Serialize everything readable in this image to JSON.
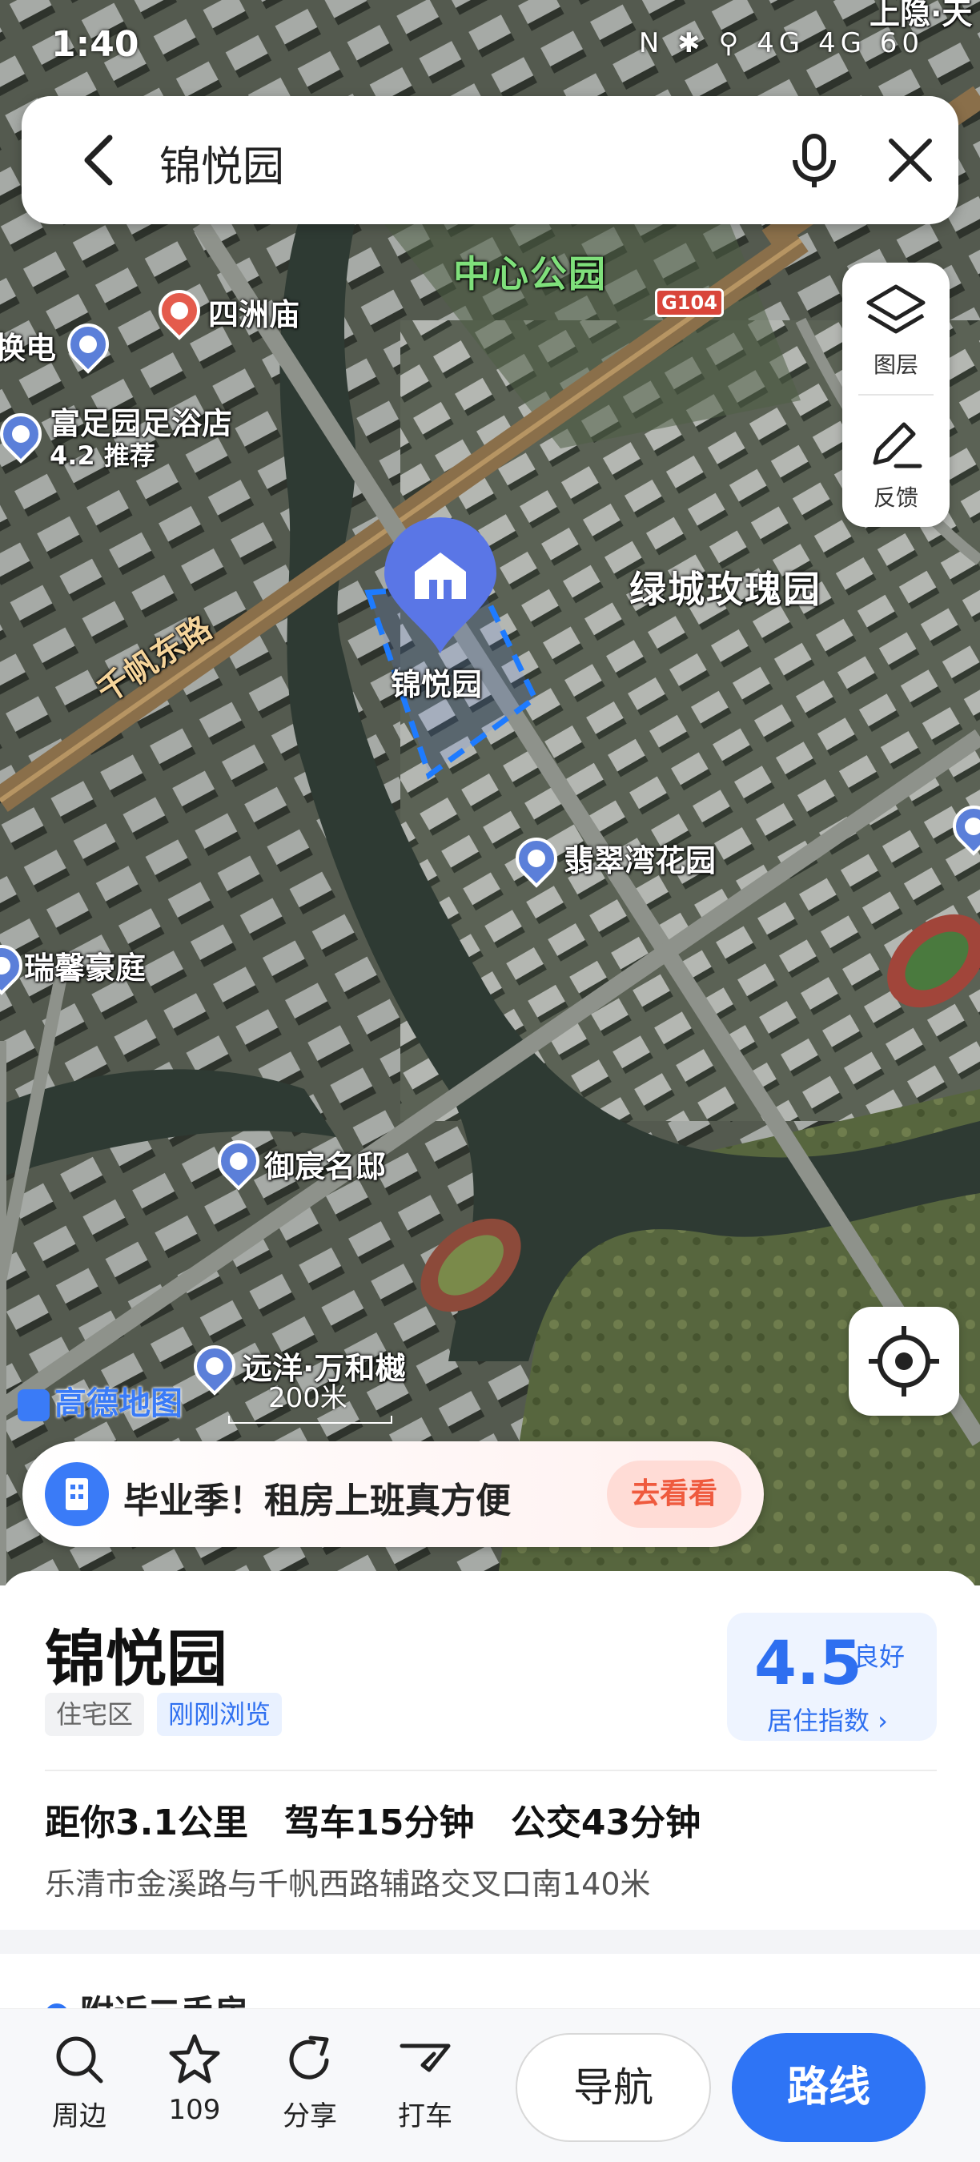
{
  "status_bar": {
    "time": "1:40",
    "right_icons": "N ✱ ⚲ 4G 4G 60",
    "top_right_poi": "上隐·天"
  },
  "search": {
    "query": "锦悦园"
  },
  "map_tools": {
    "layers_label": "图层",
    "feedback_label": "反馈"
  },
  "map_labels": {
    "central_park": "中心公园",
    "highway": "G104",
    "sizhou_temple": "四洲庙",
    "partial_left": "换电",
    "foot_spa": "富足园足浴店",
    "foot_spa_sub": "4.2 推荐",
    "road": "千帆东路",
    "lvcheng": "绿城玫瑰园",
    "selected": "锦悦园",
    "feicui": "翡翠湾花园",
    "ruixin": "瑞馨豪庭",
    "yuchen": "御宸名邸",
    "yuanyang": "远洋·万和樾"
  },
  "map_footer": {
    "brand": "高德地图",
    "scale": "200米"
  },
  "banner": {
    "text": "毕业季！租房上班真方便",
    "button": "去看看"
  },
  "place": {
    "title": "锦悦园",
    "tag_type": "住宅区",
    "tag_recent": "刚刚浏览",
    "score": "4.5",
    "score_level": "良好",
    "score_label": "居住指数 ›",
    "distance": "距你3.1公里",
    "drive": "驾车15分钟",
    "transit": "公交43分钟",
    "address": "乐清市金溪路与千帆西路辅路交叉口南140米",
    "next_section": "附近二手房"
  },
  "actions": {
    "nearby": "周边",
    "favorites": "109",
    "share": "分享",
    "taxi": "打车",
    "navigate": "导航",
    "route": "路线"
  },
  "colors": {
    "accent": "#2e74f5",
    "banner_button": "#ef5a3e",
    "selection_outline": "#1e7bff"
  }
}
